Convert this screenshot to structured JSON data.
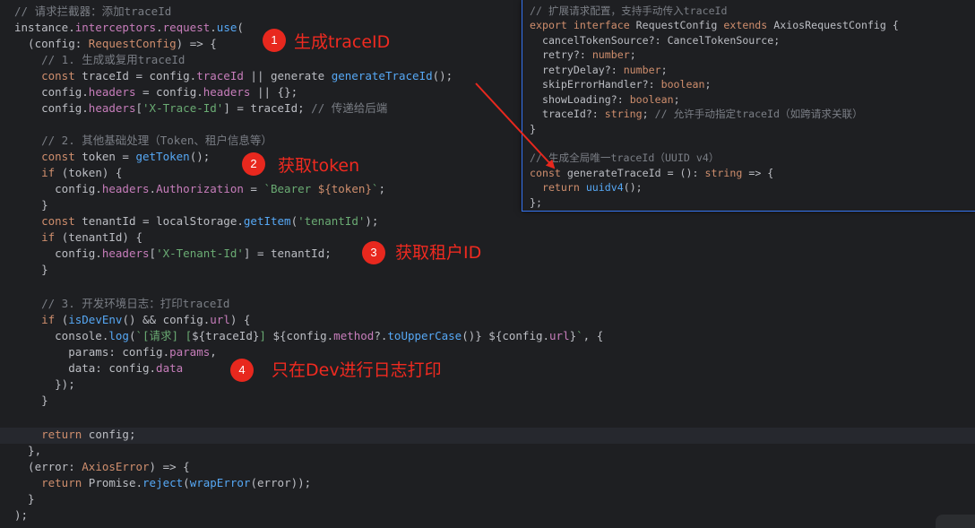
{
  "code": {
    "l1": "// 请求拦截器：添加traceId",
    "l2_a": "instance.",
    "l2_b": "interceptors",
    "l2_c": ".",
    "l2_d": "request",
    "l2_e": ".",
    "l2_f": "use",
    "l2_g": "(",
    "l3_a": "  (config: ",
    "l3_b": "RequestConfig",
    "l3_c": ") => {",
    "l4": "    // 1. 生成或复用traceId",
    "l5_a": "    const ",
    "l5_b": "traceId = config.",
    "l5_c": "traceId",
    "l5_d": " || generate ",
    "l5_e": "generateTraceId",
    "l5_f": "();",
    "l6_a": "    config.",
    "l6_b": "headers",
    "l6_c": " = config.",
    "l6_d": "headers",
    "l6_e": " || {};",
    "l7_a": "    config.",
    "l7_b": "headers",
    "l7_c": "[",
    "l7_d": "'X-Trace-Id'",
    "l7_e": "] = traceId; ",
    "l7_f": "// 传递给后端",
    "l9": "    // 2. 其他基础处理（Token、租户信息等）",
    "l10_a": "    const ",
    "l10_b": "token = ",
    "l10_c": "getToken",
    "l10_d": "();",
    "l11_a": "    if ",
    "l11_b": "(token) {",
    "l12_a": "      config.",
    "l12_b": "headers",
    "l12_c": ".",
    "l12_d": "Authorization",
    "l12_e": " = ",
    "l12_f": "`Bearer ",
    "l12_g": "${token}",
    "l12_h": "`",
    "l12_i": ";",
    "l13": "    }",
    "l14_a": "    const ",
    "l14_b": "tenantId = localStorage.",
    "l14_c": "getItem",
    "l14_d": "(",
    "l14_e": "'tenantId'",
    "l14_f": ");",
    "l15_a": "    if ",
    "l15_b": "(tenantId) {",
    "l16_a": "      config.",
    "l16_b": "headers",
    "l16_c": "[",
    "l16_d": "'X-Tenant-Id'",
    "l16_e": "] = tenantId;",
    "l17": "    }",
    "l19": "    // 3. 开发环境日志：打印traceId",
    "l20_a": "    if ",
    "l20_b": "(",
    "l20_c": "isDevEnv",
    "l20_d": "() && config.",
    "l20_e": "url",
    "l20_f": ") {",
    "l21_a": "      console.",
    "l21_b": "log",
    "l21_c": "(",
    "l21_d": "`[请求] [",
    "l21_e": "${traceId}",
    "l21_f": "] ",
    "l21_g": "${config.",
    "l21_h": "method",
    "l21_i": "?.",
    "l21_j": "toUpperCase",
    "l21_k": "()}",
    "l21_l": " ",
    "l21_m": "${config.",
    "l21_n": "url",
    "l21_o": "}",
    "l21_p": "`",
    "l21_q": ", {",
    "l22_a": "        params: config.",
    "l22_b": "params",
    "l22_c": ",",
    "l23_a": "        data: config.",
    "l23_b": "data",
    "l24": "      });",
    "l25": "    }",
    "l27_a": "    return ",
    "l27_b": "config;",
    "l28": "  },",
    "l29_a": "  (error: ",
    "l29_b": "AxiosError",
    "l29_c": ") => {",
    "l30_a": "    return ",
    "l30_b": "Promise.",
    "l30_c": "reject",
    "l30_d": "(",
    "l30_e": "wrapError",
    "l30_f": "(error));",
    "l31": "  }",
    "l32": ");"
  },
  "popup": {
    "p1": "// 扩展请求配置，支持手动传入traceId",
    "p2_a": "export interface ",
    "p2_b": "RequestConfig ",
    "p2_c": "extends ",
    "p2_d": "AxiosRequestConfig",
    "p2_e": " {",
    "p3_a": "  cancelTokenSource?: ",
    "p3_b": "CancelTokenSource",
    "p3_c": ";",
    "p4_a": "  retry?: ",
    "p4_b": "number",
    "p4_c": ";",
    "p5_a": "  retryDelay?: ",
    "p5_b": "number",
    "p5_c": ";",
    "p6_a": "  skipErrorHandler?: ",
    "p6_b": "boolean",
    "p6_c": ";",
    "p7_a": "  showLoading?: ",
    "p7_b": "boolean",
    "p7_c": ";",
    "p8_a": "  traceId?: ",
    "p8_b": "string",
    "p8_c": "; ",
    "p8_d": "// 允许手动指定traceId（如跨请求关联）",
    "p9": "}",
    "p11": "// 生成全局唯一traceId（UUID v4）",
    "p12_a": "const ",
    "p12_b": "generateTraceId",
    "p12_c": " = (): ",
    "p12_d": "string",
    "p12_e": " => {",
    "p13_a": "  return ",
    "p13_b": "uuidv4",
    "p13_c": "();",
    "p14": "};"
  },
  "annotations": [
    {
      "number": "1",
      "text": "生成traceID"
    },
    {
      "number": "2",
      "text": "获取token"
    },
    {
      "number": "3",
      "text": "获取租户ID"
    },
    {
      "number": "4",
      "text": "只在Dev进行日志打印"
    }
  ],
  "colors": {
    "keyword": "#cf8e6d",
    "property": "#c77dbb",
    "function": "#56a8f5",
    "string": "#6aab73",
    "comment": "#7a7e85",
    "annotation": "#e8281e",
    "popup_border": "#3574f0"
  }
}
